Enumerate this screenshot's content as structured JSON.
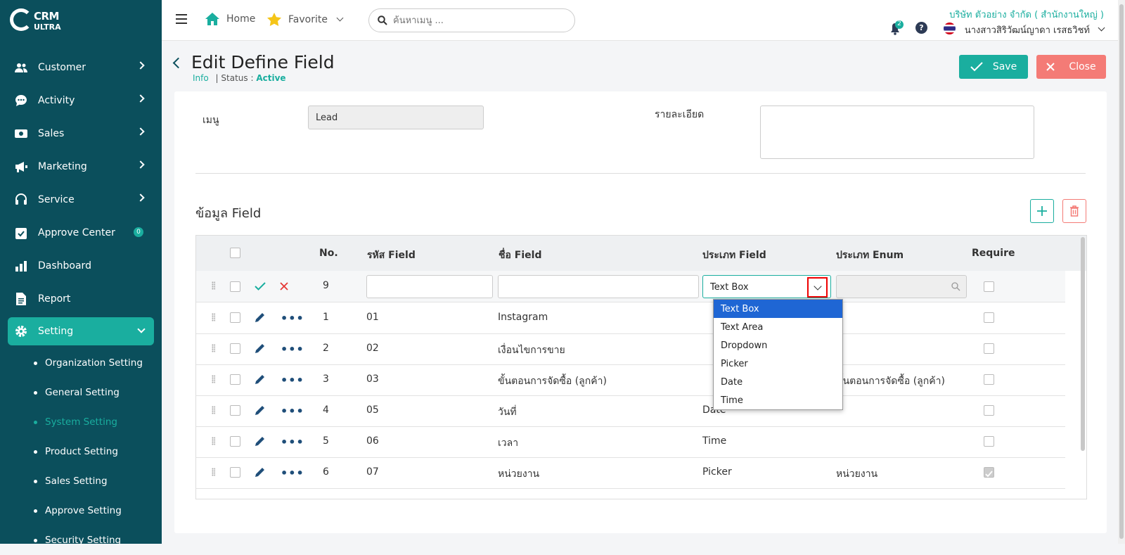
{
  "app": {
    "logo_line1": "CRM",
    "logo_line2": "ULTRA"
  },
  "sidebar": {
    "items": [
      {
        "label": "Customer"
      },
      {
        "label": "Activity"
      },
      {
        "label": "Sales"
      },
      {
        "label": "Marketing"
      },
      {
        "label": "Service"
      },
      {
        "label": "Approve Center",
        "badge": "0"
      },
      {
        "label": "Dashboard"
      },
      {
        "label": "Report"
      },
      {
        "label": "Setting"
      }
    ],
    "submenu": [
      {
        "label": "Organization Setting"
      },
      {
        "label": "General Setting"
      },
      {
        "label": "System Setting"
      },
      {
        "label": "Product Setting"
      },
      {
        "label": "Sales Setting"
      },
      {
        "label": "Approve Setting"
      },
      {
        "label": "Security Setting"
      }
    ]
  },
  "topbar": {
    "home": "Home",
    "favorite": "Favorite",
    "search_placeholder": "ค้นหาเมนู ...",
    "company": "บริษัท ตัวอย่าง จำกัด ( สำนักงานใหญ่ )",
    "user": "นางสาวสิริวัฒน์ญาดา เรสธวิชท์",
    "notification_count": "2",
    "help": "?"
  },
  "page": {
    "title": "Edit Define Field",
    "info": "Info",
    "status_label": "| Status :",
    "status_value": "Active",
    "save": "Save",
    "close": "Close"
  },
  "form": {
    "menu_label": "เมนู",
    "menu_value": "Lead",
    "detail_label": "รายละเอียด",
    "section_title": "ข้อมูล Field"
  },
  "table": {
    "headers": {
      "no": "No.",
      "code": "รหัส Field",
      "name": "ชื่อ Field",
      "type": "ประเภท Field",
      "enum": "ประเภท Enum",
      "require": "Require"
    },
    "edit_row": {
      "no": "9",
      "type": "Text Box"
    },
    "rows": [
      {
        "no": "1",
        "code": "01",
        "name": "Instagram",
        "type": "",
        "enum": "",
        "require": false
      },
      {
        "no": "2",
        "code": "02",
        "name": "เงื่อนไขการขาย",
        "type": "",
        "enum": "",
        "require": false
      },
      {
        "no": "3",
        "code": "03",
        "name": "ขั้นตอนการจัดซื้อ (ลูกค้า)",
        "type": "",
        "enum": "ขั้นตอนการจัดซื้อ (ลูกค้า)",
        "require": false
      },
      {
        "no": "4",
        "code": "05",
        "name": "วันที่",
        "type": "Date",
        "enum": "",
        "require": false
      },
      {
        "no": "5",
        "code": "06",
        "name": "เวลา",
        "type": "Time",
        "enum": "",
        "require": false
      },
      {
        "no": "6",
        "code": "07",
        "name": "หน่วยงาน",
        "type": "Picker",
        "enum": "หน่วยงาน",
        "require": true
      }
    ]
  },
  "dropdown": {
    "options": [
      "Text Box",
      "Text Area",
      "Dropdown",
      "Picker",
      "Date",
      "Time"
    ],
    "selected": "Text Box"
  },
  "colors": {
    "sidebar": "#0b4f5c",
    "accent": "#1aae9f",
    "danger": "#f47b76"
  }
}
